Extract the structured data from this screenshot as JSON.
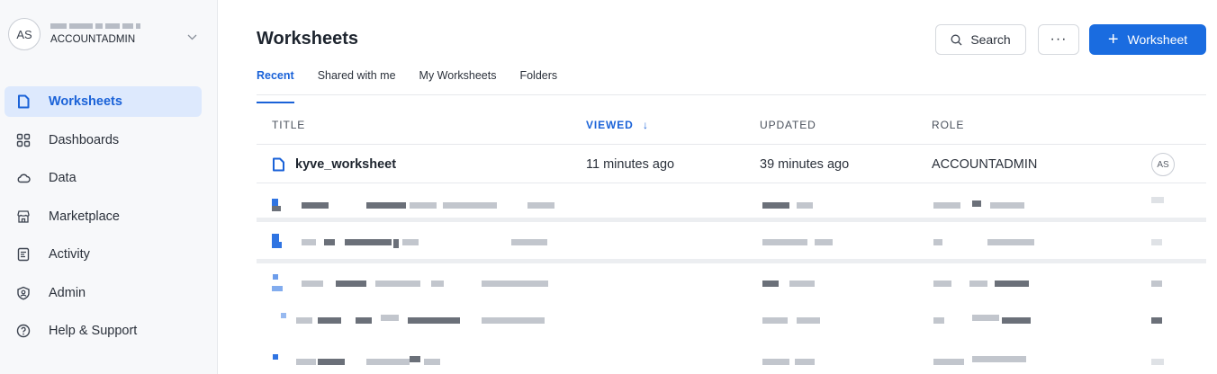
{
  "account": {
    "initials": "AS",
    "role": "ACCOUNTADMIN"
  },
  "nav": {
    "items": [
      {
        "label": "Worksheets",
        "icon": "worksheet-icon",
        "active": true
      },
      {
        "label": "Dashboards",
        "icon": "dashboard-grid-icon"
      },
      {
        "label": "Data",
        "icon": "cloud-icon"
      },
      {
        "label": "Marketplace",
        "icon": "storefront-icon"
      },
      {
        "label": "Activity",
        "icon": "activity-document-icon"
      },
      {
        "label": "Admin",
        "icon": "shield-admin-icon"
      },
      {
        "label": "Help & Support",
        "icon": "help-circle-icon"
      }
    ]
  },
  "header": {
    "title": "Worksheets",
    "search_label": "Search",
    "more_label": "···",
    "new_worksheet_label": "Worksheet",
    "tabs": [
      "Recent",
      "Shared with me",
      "My Worksheets",
      "Folders"
    ]
  },
  "table": {
    "columns": [
      "TITLE",
      "VIEWED",
      "UPDATED",
      "ROLE"
    ],
    "sort_indicator": "↓",
    "rows": [
      {
        "title": "kyve_worksheet",
        "viewed": "11 minutes ago",
        "updated": "39 minutes ago",
        "role": "ACCOUNTADMIN",
        "owner_initials": "AS"
      }
    ]
  },
  "colors": {
    "accent": "#1a6ce0",
    "active_nav_bg": "#dde9fd"
  }
}
